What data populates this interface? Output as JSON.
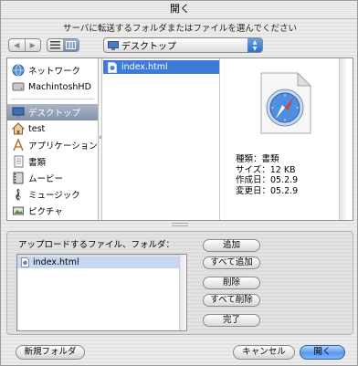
{
  "window": {
    "title": "開く"
  },
  "instruction": "サーバに転送するフォルダまたはファイルを選んでください",
  "toolbar": {
    "back_icon": "back-arrow-icon",
    "forward_icon": "forward-arrow-icon",
    "view_modes": [
      "list-view-icon",
      "column-view-icon"
    ],
    "location": "デスクトップ"
  },
  "sidebar": {
    "devices": [
      {
        "label": "ネットワーク",
        "icon": "network-globe-icon"
      },
      {
        "label": "MachintoshHD",
        "icon": "hard-drive-icon"
      }
    ],
    "places": [
      {
        "label": "デスクトップ",
        "icon": "desktop-icon",
        "selected": true
      },
      {
        "label": "test",
        "icon": "home-icon"
      },
      {
        "label": "アプリケーション",
        "icon": "applications-icon"
      },
      {
        "label": "書類",
        "icon": "documents-icon"
      },
      {
        "label": "ムービー",
        "icon": "movies-icon"
      },
      {
        "label": "ミュージック",
        "icon": "music-icon"
      },
      {
        "label": "ピクチャ",
        "icon": "pictures-icon"
      }
    ]
  },
  "column": {
    "items": [
      {
        "label": "index.html",
        "selected": true
      }
    ]
  },
  "preview": {
    "icon": "safari-document-icon",
    "kind": "種類：書類",
    "size": "サイズ：12 KB",
    "created": "作成日：05.2.9",
    "modified": "変更日：05.2.9"
  },
  "upload": {
    "label": "アップロードするファイル、フォルダ：",
    "files": [
      "index.html"
    ],
    "buttons": {
      "add": "追加",
      "add_all": "すべて追加",
      "remove": "削除",
      "remove_all": "すべて削除",
      "done": "完了"
    }
  },
  "footer": {
    "new_folder": "新規フォルダ",
    "cancel": "キャンセル",
    "open": "開く"
  },
  "colors": {
    "selection_blue": "#3d7bd8",
    "sidebar_selection": "#8d9bb0",
    "default_button": "#5a99ea"
  }
}
